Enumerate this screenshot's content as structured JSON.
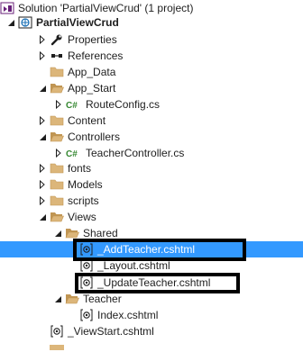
{
  "tree": [
    {
      "label": "Solution 'PartialViewCrud' (1 project)",
      "icon": "solution-icon",
      "expander": "none"
    },
    {
      "label": "PartialViewCrud",
      "icon": "web-project-icon",
      "expander": "expanded",
      "bold": true
    },
    {
      "label": "Properties",
      "icon": "wrench-icon",
      "expander": "collapsed"
    },
    {
      "label": "References",
      "icon": "references-icon",
      "expander": "collapsed"
    },
    {
      "label": "App_Data",
      "icon": "folder-icon",
      "expander": "none"
    },
    {
      "label": "App_Start",
      "icon": "folder-open-icon",
      "expander": "expanded"
    },
    {
      "label": "RouteConfig.cs",
      "icon": "csharp-file-icon",
      "expander": "collapsed"
    },
    {
      "label": "Content",
      "icon": "folder-icon",
      "expander": "collapsed"
    },
    {
      "label": "Controllers",
      "icon": "folder-open-icon",
      "expander": "expanded"
    },
    {
      "label": "TeacherController.cs",
      "icon": "csharp-file-icon",
      "expander": "collapsed"
    },
    {
      "label": "fonts",
      "icon": "folder-icon",
      "expander": "collapsed"
    },
    {
      "label": "Models",
      "icon": "folder-icon",
      "expander": "collapsed"
    },
    {
      "label": "scripts",
      "icon": "folder-icon",
      "expander": "collapsed"
    },
    {
      "label": "Views",
      "icon": "folder-open-icon",
      "expander": "expanded"
    },
    {
      "label": "Shared",
      "icon": "folder-open-icon",
      "expander": "expanded"
    },
    {
      "label": "_AddTeacher.cshtml",
      "icon": "razor-file-icon",
      "expander": "none",
      "selected": true
    },
    {
      "label": "_Layout.cshtml",
      "icon": "razor-file-icon",
      "expander": "none"
    },
    {
      "label": "_UpdateTeacher.cshtml",
      "icon": "razor-file-icon",
      "expander": "none"
    },
    {
      "label": "Teacher",
      "icon": "folder-open-icon",
      "expander": "expanded"
    },
    {
      "label": "Index.cshtml",
      "icon": "razor-file-icon",
      "expander": "none"
    },
    {
      "label": "_ViewStart.cshtml",
      "icon": "razor-file-icon",
      "expander": "none"
    }
  ],
  "colors": {
    "selection": "#3399ff",
    "folder": "#dcb67a",
    "folder_dark": "#c09553",
    "csharp": "#368832",
    "highlight_box": "#000000"
  }
}
